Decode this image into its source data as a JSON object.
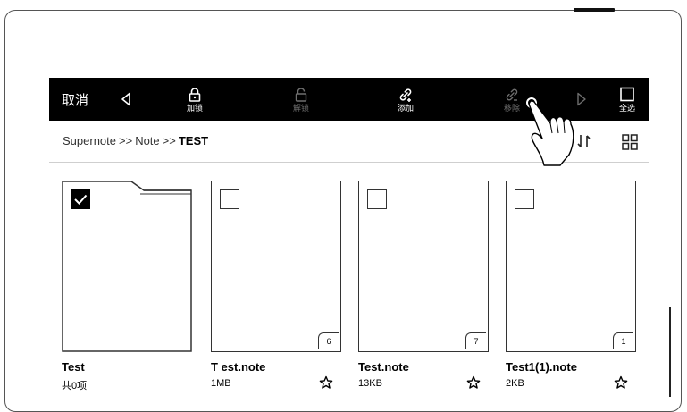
{
  "toolbar": {
    "cancel_label": "取消",
    "lock_label": "加锁",
    "unlock_label": "解锁",
    "add_label": "添加",
    "remove_label": "移除",
    "select_all_label": "全选"
  },
  "breadcrumb": {
    "segments": [
      "Supernote",
      "Note",
      "TEST"
    ],
    "separator": ">>"
  },
  "files": [
    {
      "name": "Test",
      "meta": "共0项",
      "type": "folder",
      "checked": true,
      "pages": "",
      "starred": false
    },
    {
      "name": "T est.note",
      "meta": "1MB",
      "type": "note",
      "checked": false,
      "pages": "6",
      "starred": true
    },
    {
      "name": "Test.note",
      "meta": "13KB",
      "type": "note",
      "checked": false,
      "pages": "7",
      "starred": true
    },
    {
      "name": "Test1(1).note",
      "meta": "2KB",
      "type": "note",
      "checked": false,
      "pages": "1",
      "starred": true
    }
  ],
  "colors": {
    "toolbar_bg": "#000000",
    "disabled": "#6f6f6f",
    "page_bg": "#ffffff"
  }
}
